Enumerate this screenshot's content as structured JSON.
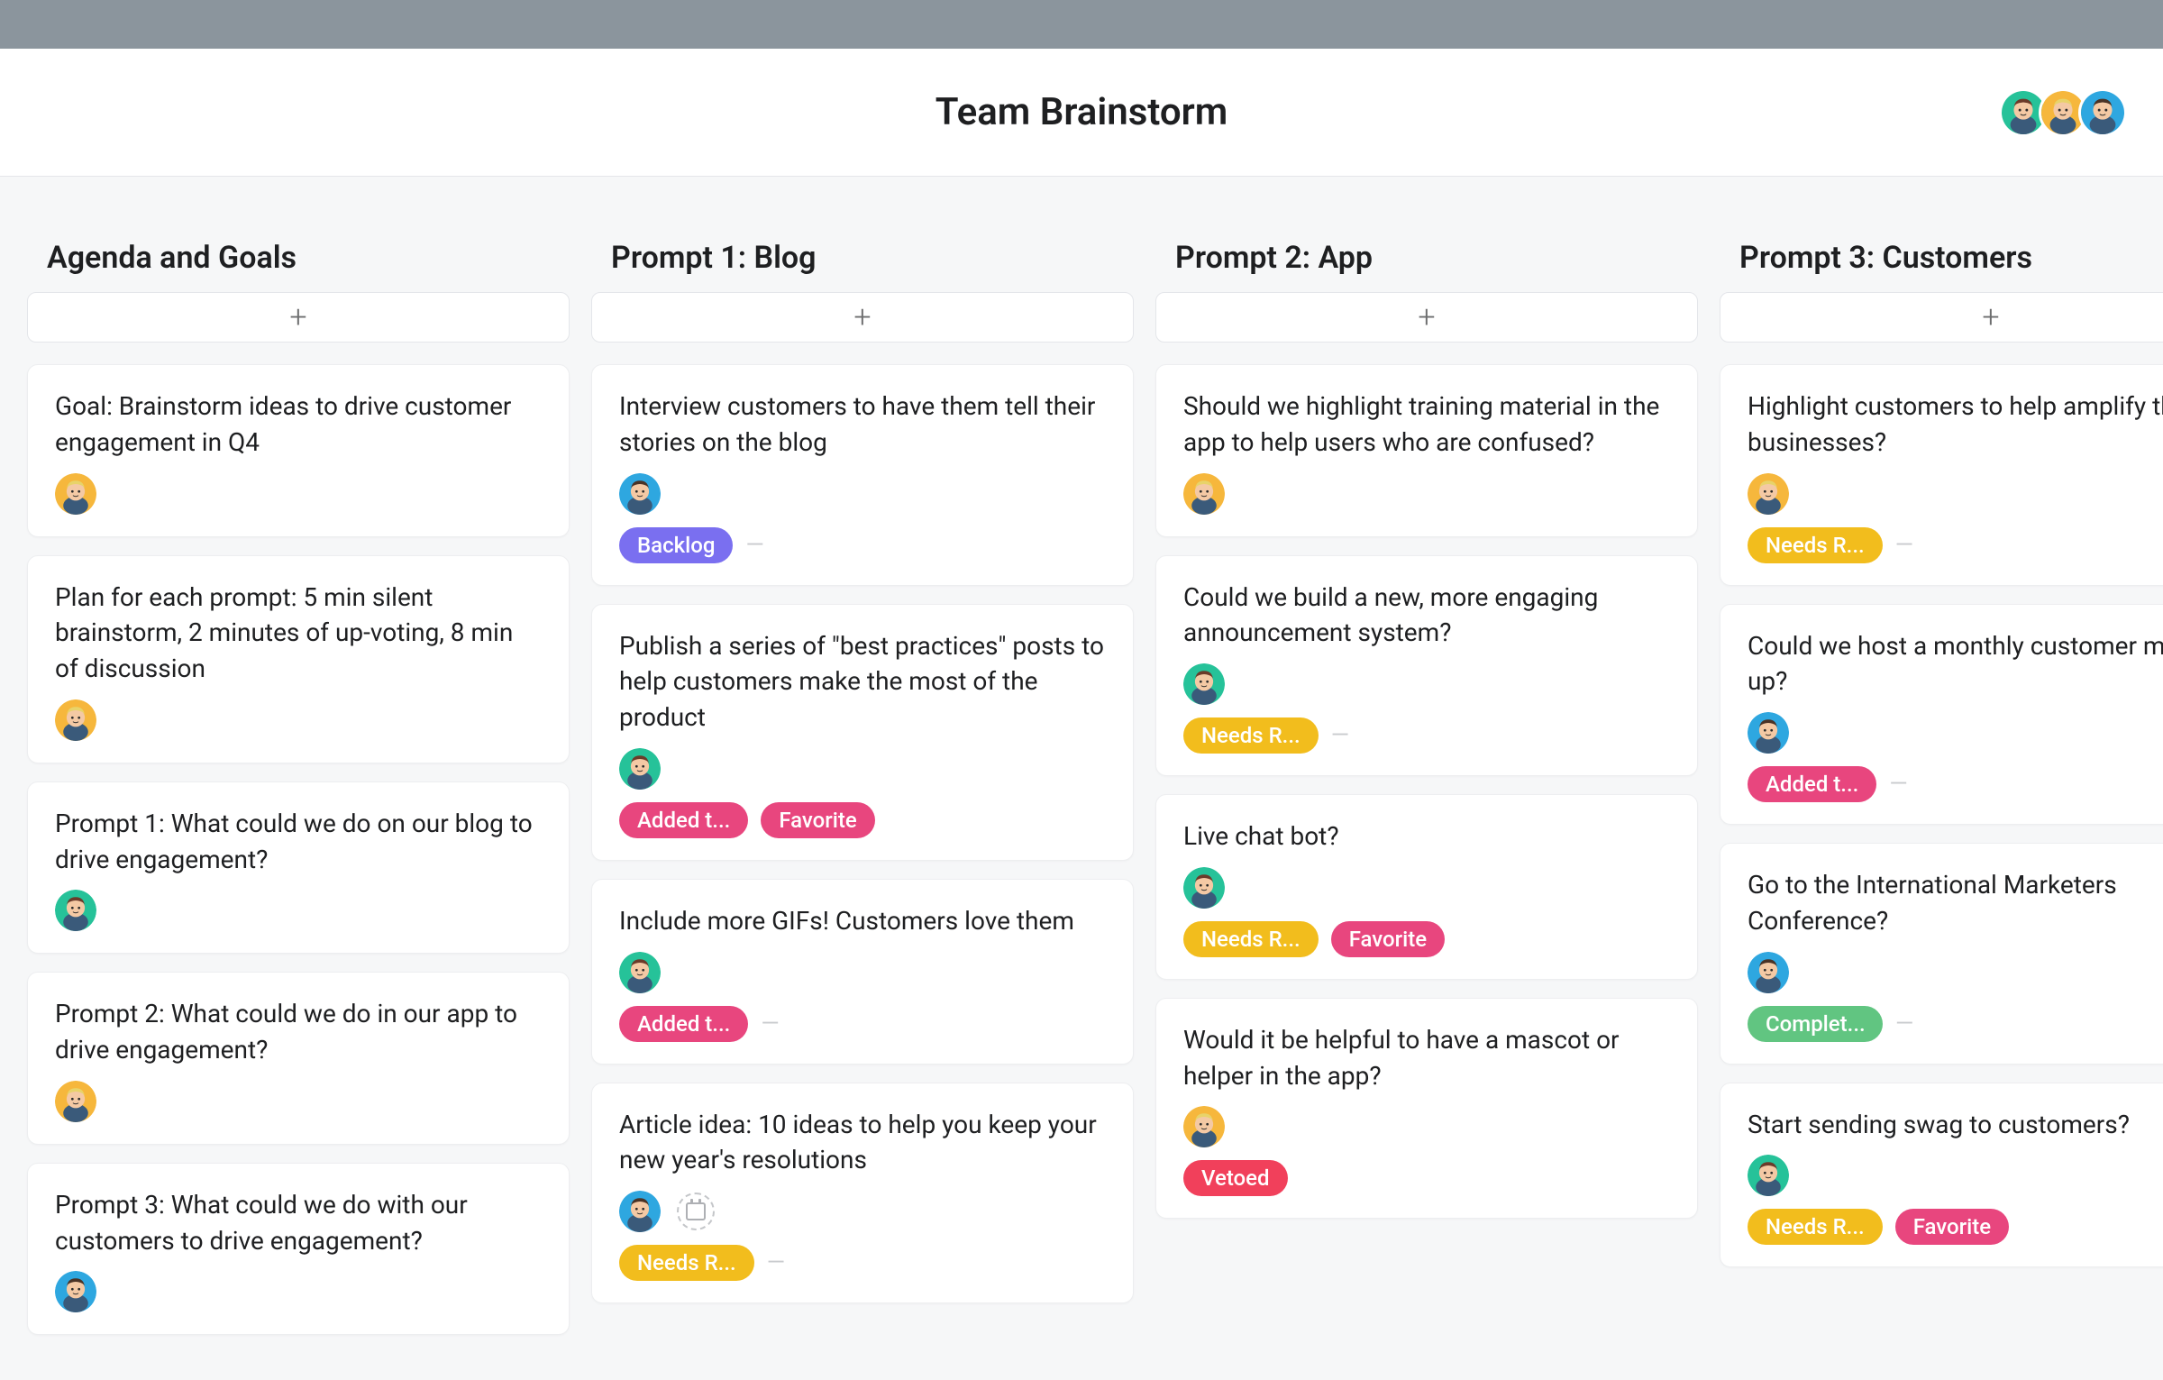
{
  "header": {
    "title": "Team Brainstorm",
    "avatars": [
      "green",
      "orange",
      "blue"
    ]
  },
  "tag_colors": {
    "Backlog": "#7a6ff0",
    "Added t...": "#e8467e",
    "Added to ...": "#e8467e",
    "Favorite": "#e8467e",
    "Needs R...": "#f2bd1d",
    "Vetoed": "#f1405b",
    "Complet...": "#61c581"
  },
  "columns": [
    {
      "title": "Agenda and Goals",
      "cards": [
        {
          "text": "Goal: Brainstorm ideas to drive customer engagement in Q4",
          "avatar": "orange",
          "tags": []
        },
        {
          "text": "Plan for each prompt: 5 min silent brainstorm, 2 minutes of up-voting, 8 min of discussion",
          "avatar": "orange",
          "tags": []
        },
        {
          "text": "Prompt 1: What could we do on our blog to drive engagement?",
          "avatar": "green",
          "tags": []
        },
        {
          "text": "Prompt 2: What could we do in our app to drive engagement?",
          "avatar": "orange",
          "tags": []
        },
        {
          "text": "Prompt 3: What could we do with our customers to drive engagement?",
          "avatar": "blue",
          "tags": []
        }
      ]
    },
    {
      "title": "Prompt 1: Blog",
      "cards": [
        {
          "text": "Interview customers to have them tell their stories on the blog",
          "avatar": "blue",
          "tags": [
            "Backlog"
          ],
          "trailing_dash": true
        },
        {
          "text": "Publish a series of \"best practices\" posts to help customers make the most of the product",
          "avatar": "green",
          "tags": [
            "Added t...",
            "Favorite"
          ]
        },
        {
          "text": "Include more GIFs! Customers love them",
          "avatar": "green",
          "tags": [
            "Added t..."
          ],
          "trailing_dash": true
        },
        {
          "text": "Article idea: 10 ideas to help you keep your new year's resolutions",
          "avatar": "blue",
          "show_date_icon": true,
          "tags": [
            "Needs R..."
          ],
          "trailing_dash": true
        }
      ]
    },
    {
      "title": "Prompt 2: App",
      "cards": [
        {
          "text": "Should we highlight training material in the app to help users who are confused?",
          "avatar": "orange",
          "tags": []
        },
        {
          "text": "Could we build a new, more engaging announcement system?",
          "avatar": "green",
          "tags": [
            "Needs R..."
          ],
          "trailing_dash": true
        },
        {
          "text": "Live chat bot?",
          "avatar": "green",
          "tags": [
            "Needs R...",
            "Favorite"
          ]
        },
        {
          "text": "Would it be helpful to have a mascot or helper in the app?",
          "avatar": "orange",
          "tags": [
            "Vetoed"
          ]
        }
      ]
    },
    {
      "title": "Prompt 3: Customers",
      "cards": [
        {
          "text": "Highlight customers to help amplify their businesses?",
          "avatar": "orange",
          "tags": [
            "Needs R..."
          ],
          "trailing_dash": true
        },
        {
          "text": "Could we host a monthly customer meet up?",
          "avatar": "blue",
          "tags": [
            "Added t..."
          ],
          "trailing_dash": true
        },
        {
          "text": "Go to the International Marketers Conference?",
          "avatar": "blue",
          "tags": [
            "Complet..."
          ],
          "trailing_dash": true
        },
        {
          "text": "Start sending swag to customers?",
          "avatar": "green",
          "tags": [
            "Needs R...",
            "Favorite"
          ]
        }
      ]
    }
  ]
}
